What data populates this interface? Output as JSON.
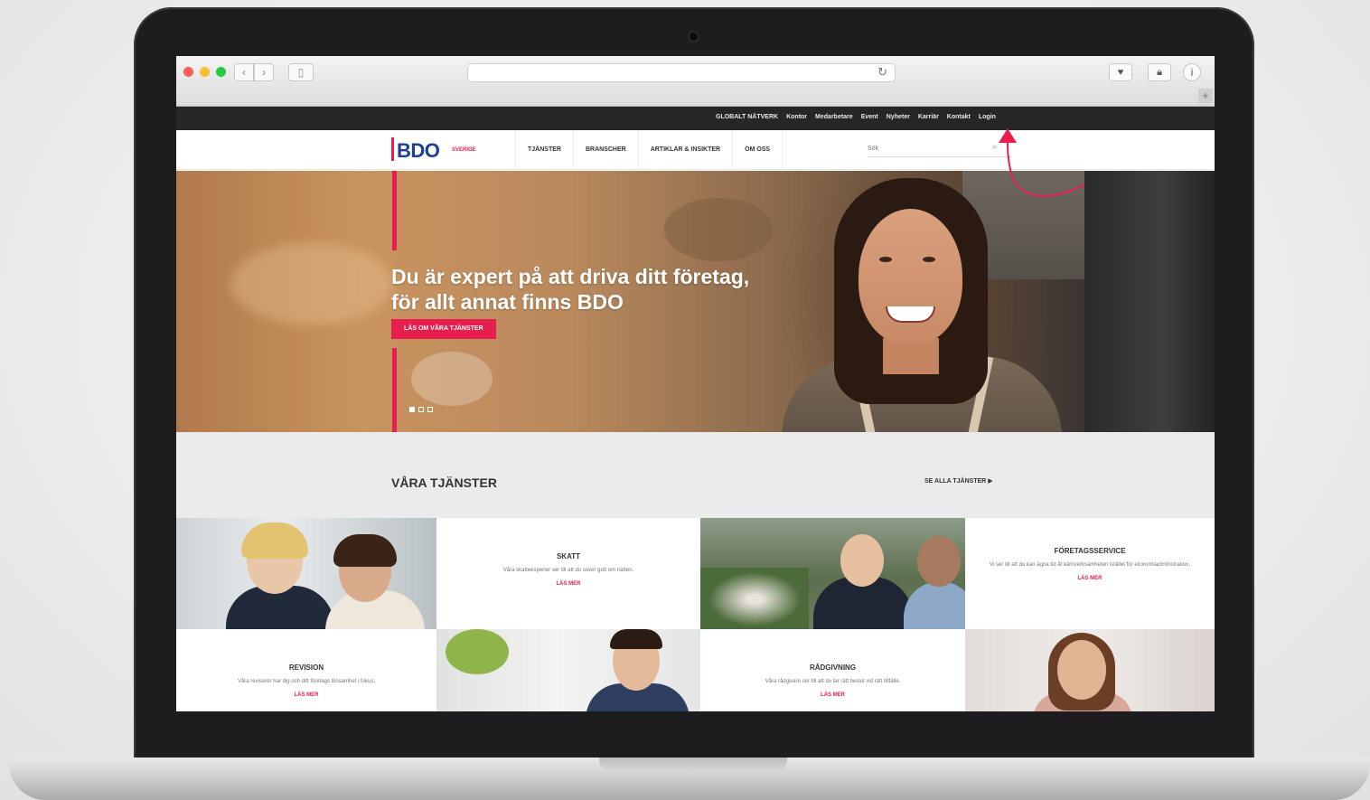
{
  "browser": {
    "url": "",
    "reload_icon": "reload-icon",
    "back_icon": "chevron-left-icon",
    "forward_icon": "chevron-right-icon"
  },
  "topbar": {
    "links": [
      "GLOBALT NÄTVERK",
      "Kontor",
      "Medarbetare",
      "Event",
      "Nyheter",
      "Karriär",
      "Kontakt",
      "Login"
    ]
  },
  "nav": {
    "logo_text": "BDO",
    "logo_sub": "SVERIGE",
    "items": [
      "TJÄNSTER",
      "BRANSCHER",
      "ARTIKLAR & INSIKTER",
      "OM OSS"
    ],
    "search_placeholder": "Sök"
  },
  "hero": {
    "heading_line1": "Du är expert på att driva ditt företag,",
    "heading_line2": "för allt annat finns BDO",
    "cta": "LÄS OM VÅRA TJÄNSTER",
    "slides": 3,
    "active_slide": 1
  },
  "services": {
    "title": "VÅRA TJÄNSTER",
    "see_all": "SE ALLA TJÄNSTER",
    "tiles": [
      {
        "title": "SKATT",
        "desc": "Våra skatteexperter ser till att du sover gott om natten.",
        "link": "LÄS MER"
      },
      {
        "title": "FÖRETAGSSERVICE",
        "desc": "Vi ser till att du kan ägna tid åt kärnverksamheten istället för ekonomiadministration.",
        "link": "LÄS MER"
      },
      {
        "title": "REVISION",
        "desc": "Våra revisorer har dig och ditt företags lönsamhet i fokus.",
        "link": "LÄS MER"
      },
      {
        "title": "RÅDGIVNING",
        "desc": "Våra rådgivare ser till att du tar rätt beslut vid rätt tillfälle.",
        "link": "LÄS MER"
      }
    ]
  },
  "colors": {
    "accent": "#e81e4f",
    "brand_blue": "#1f3f8f",
    "topbar": "#262626"
  }
}
